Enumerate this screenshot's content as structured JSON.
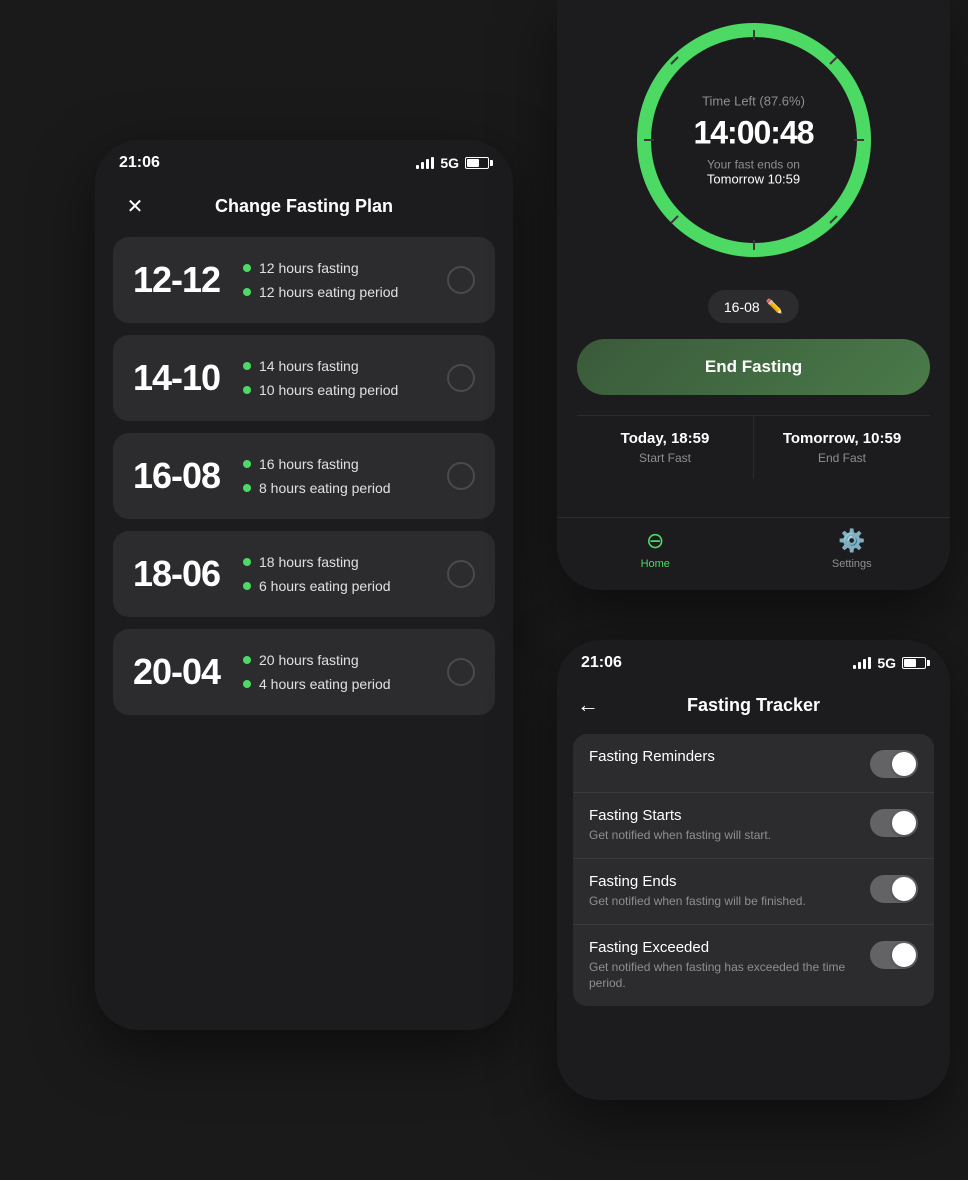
{
  "leftPhone": {
    "statusBar": {
      "time": "21:06",
      "signal": "5G"
    },
    "header": {
      "title": "Change Fasting Plan",
      "closeLabel": "×"
    },
    "plans": [
      {
        "id": "12-12",
        "number": "12-12",
        "detail1": "12 hours fasting",
        "detail2": "12 hours eating period"
      },
      {
        "id": "14-10",
        "number": "14-10",
        "detail1": "14 hours fasting",
        "detail2": "10 hours eating period"
      },
      {
        "id": "16-08",
        "number": "16-08",
        "detail1": "16 hours fasting",
        "detail2": "8 hours eating period"
      },
      {
        "id": "18-06",
        "number": "18-06",
        "detail1": "18 hours fasting",
        "detail2": "6 hours eating period"
      },
      {
        "id": "20-04",
        "number": "20-04",
        "detail1": "20 hours fasting",
        "detail2": "4 hours eating period"
      }
    ]
  },
  "rightTopPhone": {
    "statusBar": {
      "time": "",
      "signal": ""
    },
    "timer": {
      "timeLeftLabel": "Time Left (87.6%)",
      "timeDisplay": "14:00:48",
      "fastEndsOnLabel": "Your fast ends on",
      "fastEndsOnValue": "Tomorrow 10:59",
      "planBadge": "16-08",
      "endFastingButton": "End Fasting",
      "startFastLabel": "Start Fast",
      "endFastLabel": "End Fast",
      "startFastTime": "Today, 18:59",
      "endFastTime": "Tomorrow, 10:59"
    },
    "nav": {
      "homeLabel": "Home",
      "settingsLabel": "Settings"
    }
  },
  "rightBottomPhone": {
    "statusBar": {
      "time": "21:06",
      "signal": "5G"
    },
    "header": {
      "title": "Fasting Tracker",
      "backLabel": "←"
    },
    "settings": [
      {
        "id": "reminders",
        "title": "Fasting Reminders",
        "subtitle": "",
        "toggled": true
      },
      {
        "id": "starts",
        "title": "Fasting Starts",
        "subtitle": "Get notified when fasting will start.",
        "toggled": false
      },
      {
        "id": "ends",
        "title": "Fasting Ends",
        "subtitle": "Get notified when fasting will be finished.",
        "toggled": false
      },
      {
        "id": "exceeded",
        "title": "Fasting Exceeded",
        "subtitle": "Get notified when fasting has exceeded the time period.",
        "toggled": false
      }
    ]
  }
}
